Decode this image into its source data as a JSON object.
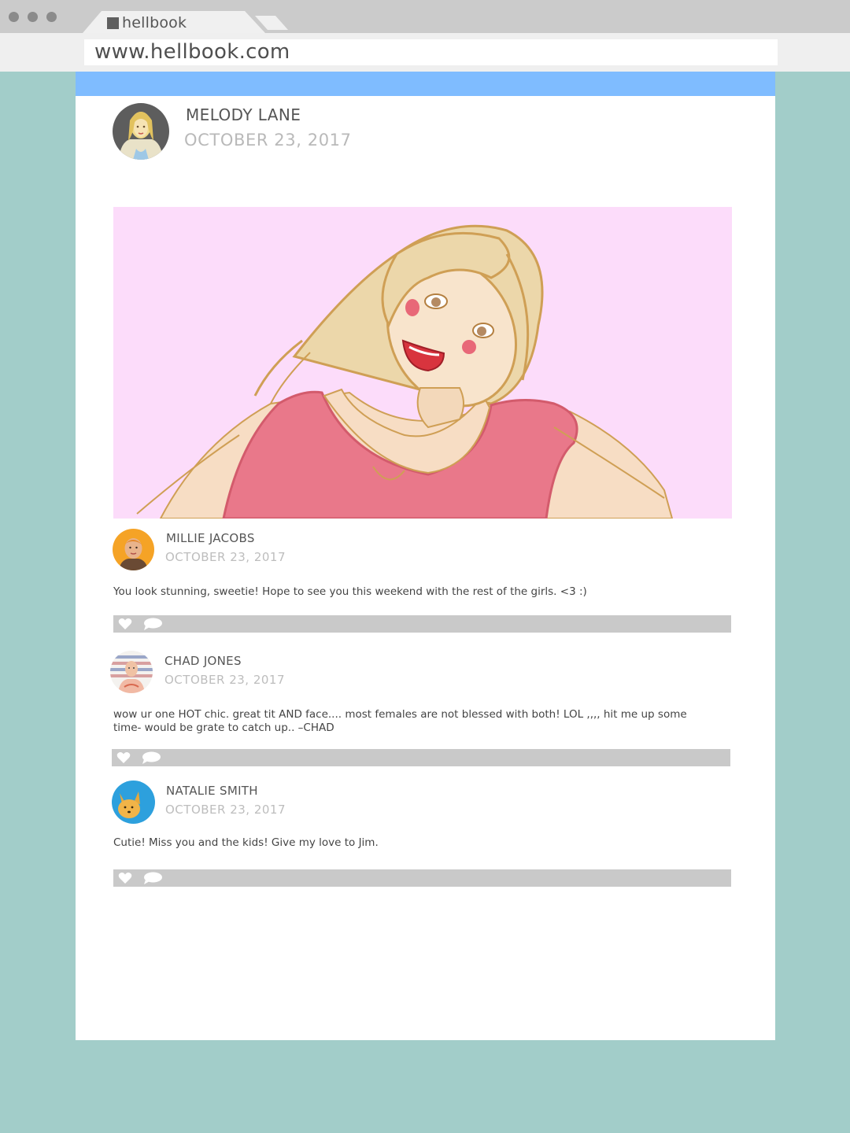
{
  "browser": {
    "tab_title": "hellbook",
    "url": "www.hellbook.com"
  },
  "post": {
    "author": "MELODY LANE",
    "date": "OCTOBER 23, 2017"
  },
  "comments": [
    {
      "author": "MILLIE JACOBS",
      "date": "OCTOBER 23, 2017",
      "text": "You look stunning, sweetie! Hope to see you this weekend with the rest of the girls. <3 :)"
    },
    {
      "author": "CHAD JONES",
      "date": "OCTOBER 23, 2017",
      "text_line1": "wow ur one HOT chic. great tit AND face.... most females are not blessed with both! LOL ,,,, hit me up some",
      "text_line2": "time- would be grate to catch up..  –CHAD"
    },
    {
      "author": "NATALIE SMITH",
      "date": "OCTOBER 23, 2017",
      "text": "Cutie! Miss you and the kids! Give my love to Jim."
    }
  ],
  "colors": {
    "background": "#a2cdc9",
    "header_bar": "#7fbcff",
    "action_bar": "#c9c9c9",
    "photo_bg": "#fcdcfa"
  },
  "icons": [
    "heart-icon",
    "comment-icon"
  ]
}
